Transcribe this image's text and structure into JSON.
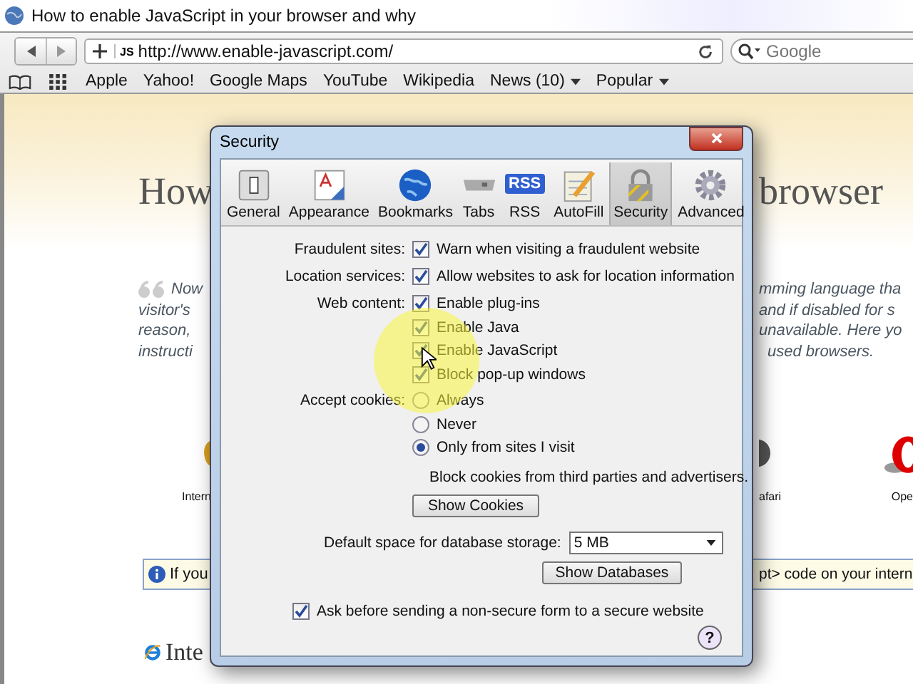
{
  "browser": {
    "title": "How to enable JavaScript in your browser and why",
    "favicon_text": "JS",
    "url": "http://www.enable-javascript.com/",
    "search_placeholder": "Google",
    "bookmarks": [
      {
        "label": "Apple",
        "kind": "link"
      },
      {
        "label": "Yahoo!",
        "kind": "link"
      },
      {
        "label": "Google Maps",
        "kind": "link"
      },
      {
        "label": "YouTube",
        "kind": "link"
      },
      {
        "label": "Wikipedia",
        "kind": "link"
      },
      {
        "label": "News (10)",
        "kind": "menu"
      },
      {
        "label": "Popular",
        "kind": "menu"
      }
    ]
  },
  "page": {
    "heading_left": "How",
    "heading_right": "browser",
    "quote_left": [
      "Now",
      "visitor's",
      "reason,",
      "instructi"
    ],
    "quote_right": [
      "mming language tha",
      "and if disabled for s",
      "unavailable. Here yo",
      "used browsers."
    ],
    "browsers_left": "Intern",
    "browsers_right": [
      "afari",
      "Ope"
    ],
    "notice_left": "If you",
    "notice_right": "pt> code on your intern",
    "section_heading": "Inte"
  },
  "security": {
    "title": "Security",
    "tabs": [
      {
        "label": "General",
        "selected": false
      },
      {
        "label": "Appearance",
        "selected": false
      },
      {
        "label": "Bookmarks",
        "selected": false
      },
      {
        "label": "Tabs",
        "selected": false
      },
      {
        "label": "RSS",
        "selected": false
      },
      {
        "label": "AutoFill",
        "selected": false
      },
      {
        "label": "Security",
        "selected": true
      },
      {
        "label": "Advanced",
        "selected": false
      }
    ],
    "rss_icon_text": "RSS",
    "groups": [
      {
        "label": "Fraudulent sites:",
        "checkboxes": [
          {
            "text": "Warn when visiting a fraudulent website",
            "checked": true
          }
        ]
      },
      {
        "label": "Location services:",
        "checkboxes": [
          {
            "text": "Allow websites to ask for location information",
            "checked": true
          }
        ]
      },
      {
        "label": "Web content:",
        "checkboxes": [
          {
            "text": "Enable plug-ins",
            "checked": true
          },
          {
            "text": "Enable Java",
            "checked": true
          },
          {
            "text": "Enable JavaScript",
            "checked": true
          },
          {
            "text": "Block pop-up windows",
            "checked": true
          }
        ]
      }
    ],
    "cookies": {
      "label": "Accept cookies:",
      "options": [
        {
          "text": "Always",
          "selected": false
        },
        {
          "text": "Never",
          "selected": false
        },
        {
          "text": "Only from sites I visit",
          "selected": true
        }
      ],
      "note": "Block cookies from third parties and advertisers.",
      "button": "Show Cookies"
    },
    "storage": {
      "label": "Default space for database storage:",
      "value": "5 MB",
      "button": "Show Databases"
    },
    "form_warning": {
      "text": "Ask before sending a non-secure form to a secure website",
      "checked": true
    },
    "help": "?"
  }
}
